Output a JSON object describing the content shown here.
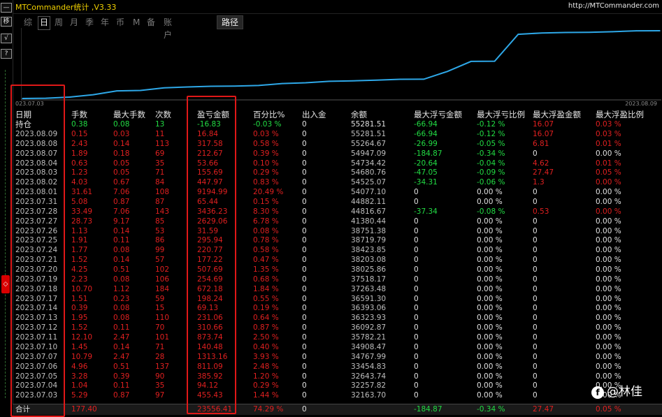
{
  "leftbar": {
    "buttons": [
      "—",
      "移",
      "√",
      "?"
    ],
    "marker": "◇"
  },
  "titlebar": {
    "title": "MTCommander统计 ,V3.33",
    "url": "http://MTCommander.com"
  },
  "tabs": [
    "综",
    "日",
    "周",
    "月",
    "季",
    "年",
    "币",
    "M",
    "备",
    "账户"
  ],
  "active_tab": "日",
  "path_button": "路径",
  "chart_data": {
    "type": "line",
    "series": [
      {
        "values": [
          32163.7,
          32257.82,
          32643.74,
          33454.83,
          34767.99,
          34908.47,
          35782.21,
          36092.87,
          36323.93,
          36393.06,
          36591.3,
          37263.48,
          37518.17,
          38025.86,
          38203.08,
          38423.85,
          38719.79,
          38751.38,
          41380.44,
          44816.67,
          44882.11,
          54077.1,
          54525.07,
          54680.76,
          54734.42,
          54947.09,
          55264.67,
          55281.51
        ]
      }
    ],
    "x_start_label": "023.07.03",
    "x_end_label": "2023.08.09",
    "color": "#2ea8e8"
  },
  "table": {
    "headers": [
      "日期",
      "手数",
      "最大手数",
      "次数",
      "盈亏金额",
      "百分比%",
      "出入金",
      "余额",
      "最大浮亏金额",
      "最大浮亏比例",
      "最大浮盈金额",
      "最大浮盈比例"
    ],
    "holding": {
      "date": "持仓",
      "lots": "0.38",
      "max_lots": "0.08",
      "count": "13",
      "pnl": "-16.83",
      "pct": "-0.03 %",
      "deposit": "0",
      "balance": "55281.51",
      "max_loss": "-66.94",
      "max_loss_pct": "-0.12 %",
      "max_profit": "16.07",
      "max_profit_pct": "0.03 %"
    },
    "rows": [
      {
        "date": "2023.08.09",
        "lots": "0.15",
        "max_lots": "0.03",
        "count": "11",
        "pnl": "16.84",
        "pct": "0.03 %",
        "deposit": "0",
        "balance": "55281.51",
        "max_loss": "-66.94",
        "max_loss_pct": "-0.12 %",
        "max_profit": "16.07",
        "max_profit_pct": "0.03 %"
      },
      {
        "date": "2023.08.08",
        "lots": "2.43",
        "max_lots": "0.14",
        "count": "113",
        "pnl": "317.58",
        "pct": "0.58 %",
        "deposit": "0",
        "balance": "55264.67",
        "max_loss": "-26.99",
        "max_loss_pct": "-0.05 %",
        "max_profit": "6.81",
        "max_profit_pct": "0.01 %"
      },
      {
        "date": "2023.08.07",
        "lots": "1.89",
        "max_lots": "0.18",
        "count": "69",
        "pnl": "212.67",
        "pct": "0.39 %",
        "deposit": "0",
        "balance": "54947.09",
        "max_loss": "-184.87",
        "max_loss_pct": "-0.34 %",
        "max_profit": "0",
        "max_profit_pct": "0.00 %"
      },
      {
        "date": "2023.08.04",
        "lots": "0.63",
        "max_lots": "0.05",
        "count": "35",
        "pnl": "53.66",
        "pct": "0.10 %",
        "deposit": "0",
        "balance": "54734.42",
        "max_loss": "-20.64",
        "max_loss_pct": "-0.04 %",
        "max_profit": "4.62",
        "max_profit_pct": "0.01 %"
      },
      {
        "date": "2023.08.03",
        "lots": "1.23",
        "max_lots": "0.05",
        "count": "71",
        "pnl": "155.69",
        "pct": "0.29 %",
        "deposit": "0",
        "balance": "54680.76",
        "max_loss": "-47.05",
        "max_loss_pct": "-0.09 %",
        "max_profit": "27.47",
        "max_profit_pct": "0.05 %"
      },
      {
        "date": "2023.08.02",
        "lots": "4.03",
        "max_lots": "0.67",
        "count": "84",
        "pnl": "447.97",
        "pct": "0.83 %",
        "deposit": "0",
        "balance": "54525.07",
        "max_loss": "-34.31",
        "max_loss_pct": "-0.06 %",
        "max_profit": "1.3",
        "max_profit_pct": "0.00 %"
      },
      {
        "date": "2023.08.01",
        "lots": "31.61",
        "max_lots": "7.06",
        "count": "108",
        "pnl": "9194.99",
        "pct": "20.49 %",
        "deposit": "0",
        "balance": "54077.10",
        "max_loss": "0",
        "max_loss_pct": "0.00 %",
        "max_profit": "0",
        "max_profit_pct": "0.00 %"
      },
      {
        "date": "2023.07.31",
        "lots": "5.08",
        "max_lots": "0.87",
        "count": "87",
        "pnl": "65.44",
        "pct": "0.15 %",
        "deposit": "0",
        "balance": "44882.11",
        "max_loss": "0",
        "max_loss_pct": "0.00 %",
        "max_profit": "0",
        "max_profit_pct": "0.00 %"
      },
      {
        "date": "2023.07.28",
        "lots": "33.49",
        "max_lots": "7.06",
        "count": "143",
        "pnl": "3436.23",
        "pct": "8.30 %",
        "deposit": "0",
        "balance": "44816.67",
        "max_loss": "-37.34",
        "max_loss_pct": "-0.08 %",
        "max_profit": "0.53",
        "max_profit_pct": "0.00 %"
      },
      {
        "date": "2023.07.27",
        "lots": "28.73",
        "max_lots": "9.17",
        "count": "85",
        "pnl": "2629.06",
        "pct": "6.78 %",
        "deposit": "0",
        "balance": "41380.44",
        "max_loss": "0",
        "max_loss_pct": "0.00 %",
        "max_profit": "0",
        "max_profit_pct": "0.00 %"
      },
      {
        "date": "2023.07.26",
        "lots": "1.13",
        "max_lots": "0.14",
        "count": "53",
        "pnl": "31.59",
        "pct": "0.08 %",
        "deposit": "0",
        "balance": "38751.38",
        "max_loss": "0",
        "max_loss_pct": "0.00 %",
        "max_profit": "0",
        "max_profit_pct": "0.00 %"
      },
      {
        "date": "2023.07.25",
        "lots": "1.91",
        "max_lots": "0.11",
        "count": "86",
        "pnl": "295.94",
        "pct": "0.78 %",
        "deposit": "0",
        "balance": "38719.79",
        "max_loss": "0",
        "max_loss_pct": "0.00 %",
        "max_profit": "0",
        "max_profit_pct": "0.00 %"
      },
      {
        "date": "2023.07.24",
        "lots": "1.77",
        "max_lots": "0.08",
        "count": "99",
        "pnl": "220.77",
        "pct": "0.58 %",
        "deposit": "0",
        "balance": "38423.85",
        "max_loss": "0",
        "max_loss_pct": "0.00 %",
        "max_profit": "0",
        "max_profit_pct": "0.00 %"
      },
      {
        "date": "2023.07.21",
        "lots": "1.52",
        "max_lots": "0.14",
        "count": "57",
        "pnl": "177.22",
        "pct": "0.47 %",
        "deposit": "0",
        "balance": "38203.08",
        "max_loss": "0",
        "max_loss_pct": "0.00 %",
        "max_profit": "0",
        "max_profit_pct": "0.00 %"
      },
      {
        "date": "2023.07.20",
        "lots": "4.25",
        "max_lots": "0.51",
        "count": "102",
        "pnl": "507.69",
        "pct": "1.35 %",
        "deposit": "0",
        "balance": "38025.86",
        "max_loss": "0",
        "max_loss_pct": "0.00 %",
        "max_profit": "0",
        "max_profit_pct": "0.00 %"
      },
      {
        "date": "2023.07.19",
        "lots": "2.23",
        "max_lots": "0.08",
        "count": "106",
        "pnl": "254.69",
        "pct": "0.68 %",
        "deposit": "0",
        "balance": "37518.17",
        "max_loss": "0",
        "max_loss_pct": "0.00 %",
        "max_profit": "0",
        "max_profit_pct": "0.00 %"
      },
      {
        "date": "2023.07.18",
        "lots": "10.70",
        "max_lots": "1.12",
        "count": "184",
        "pnl": "672.18",
        "pct": "1.84 %",
        "deposit": "0",
        "balance": "37263.48",
        "max_loss": "0",
        "max_loss_pct": "0.00 %",
        "max_profit": "0",
        "max_profit_pct": "0.00 %"
      },
      {
        "date": "2023.07.17",
        "lots": "1.51",
        "max_lots": "0.23",
        "count": "59",
        "pnl": "198.24",
        "pct": "0.55 %",
        "deposit": "0",
        "balance": "36591.30",
        "max_loss": "0",
        "max_loss_pct": "0.00 %",
        "max_profit": "0",
        "max_profit_pct": "0.00 %"
      },
      {
        "date": "2023.07.14",
        "lots": "0.39",
        "max_lots": "0.08",
        "count": "15",
        "pnl": "69.13",
        "pct": "0.19 %",
        "deposit": "0",
        "balance": "36393.06",
        "max_loss": "0",
        "max_loss_pct": "0.00 %",
        "max_profit": "0",
        "max_profit_pct": "0.00 %"
      },
      {
        "date": "2023.07.13",
        "lots": "1.95",
        "max_lots": "0.08",
        "count": "110",
        "pnl": "231.06",
        "pct": "0.64 %",
        "deposit": "0",
        "balance": "36323.93",
        "max_loss": "0",
        "max_loss_pct": "0.00 %",
        "max_profit": "0",
        "max_profit_pct": "0.00 %"
      },
      {
        "date": "2023.07.12",
        "lots": "1.52",
        "max_lots": "0.11",
        "count": "70",
        "pnl": "310.66",
        "pct": "0.87 %",
        "deposit": "0",
        "balance": "36092.87",
        "max_loss": "0",
        "max_loss_pct": "0.00 %",
        "max_profit": "0",
        "max_profit_pct": "0.00 %"
      },
      {
        "date": "2023.07.11",
        "lots": "12.10",
        "max_lots": "2.47",
        "count": "101",
        "pnl": "873.74",
        "pct": "2.50 %",
        "deposit": "0",
        "balance": "35782.21",
        "max_loss": "0",
        "max_loss_pct": "0.00 %",
        "max_profit": "0",
        "max_profit_pct": "0.00 %"
      },
      {
        "date": "2023.07.10",
        "lots": "1.45",
        "max_lots": "0.14",
        "count": "71",
        "pnl": "140.48",
        "pct": "0.40 %",
        "deposit": "0",
        "balance": "34908.47",
        "max_loss": "0",
        "max_loss_pct": "0.00 %",
        "max_profit": "0",
        "max_profit_pct": "0.00 %"
      },
      {
        "date": "2023.07.07",
        "lots": "10.79",
        "max_lots": "2.47",
        "count": "28",
        "pnl": "1313.16",
        "pct": "3.93 %",
        "deposit": "0",
        "balance": "34767.99",
        "max_loss": "0",
        "max_loss_pct": "0.00 %",
        "max_profit": "0",
        "max_profit_pct": "0.00 %"
      },
      {
        "date": "2023.07.06",
        "lots": "4.96",
        "max_lots": "0.51",
        "count": "137",
        "pnl": "811.09",
        "pct": "2.48 %",
        "deposit": "0",
        "balance": "33454.83",
        "max_loss": "0",
        "max_loss_pct": "0.00 %",
        "max_profit": "0",
        "max_profit_pct": "0.00 %"
      },
      {
        "date": "2023.07.05",
        "lots": "3.28",
        "max_lots": "0.39",
        "count": "90",
        "pnl": "385.92",
        "pct": "1.20 %",
        "deposit": "0",
        "balance": "32643.74",
        "max_loss": "0",
        "max_loss_pct": "0.00 %",
        "max_profit": "0",
        "max_profit_pct": "0.00 %"
      },
      {
        "date": "2023.07.04",
        "lots": "1.04",
        "max_lots": "0.11",
        "count": "35",
        "pnl": "94.12",
        "pct": "0.29 %",
        "deposit": "0",
        "balance": "32257.82",
        "max_loss": "0",
        "max_loss_pct": "0.00 %",
        "max_profit": "0",
        "max_profit_pct": "0.00 %"
      },
      {
        "date": "2023.07.03",
        "lots": "5.29",
        "max_lots": "0.87",
        "count": "97",
        "pnl": "455.43",
        "pct": "1.44 %",
        "deposit": "0",
        "balance": "32163.70",
        "max_loss": "0",
        "max_loss_pct": "0.00 %",
        "max_profit": "0",
        "max_profit_pct": "0.00 %"
      }
    ],
    "total": {
      "date": "合计",
      "lots": "177.40",
      "pnl": "23556.41",
      "pct": "74.29 %",
      "deposit": "0",
      "max_loss": "-184.87",
      "max_loss_pct": "-0.34 %",
      "max_profit": "27.47",
      "max_profit_pct": "0.05 %"
    }
  },
  "watermark": {
    "logo": "f",
    "text": "@林佳"
  }
}
